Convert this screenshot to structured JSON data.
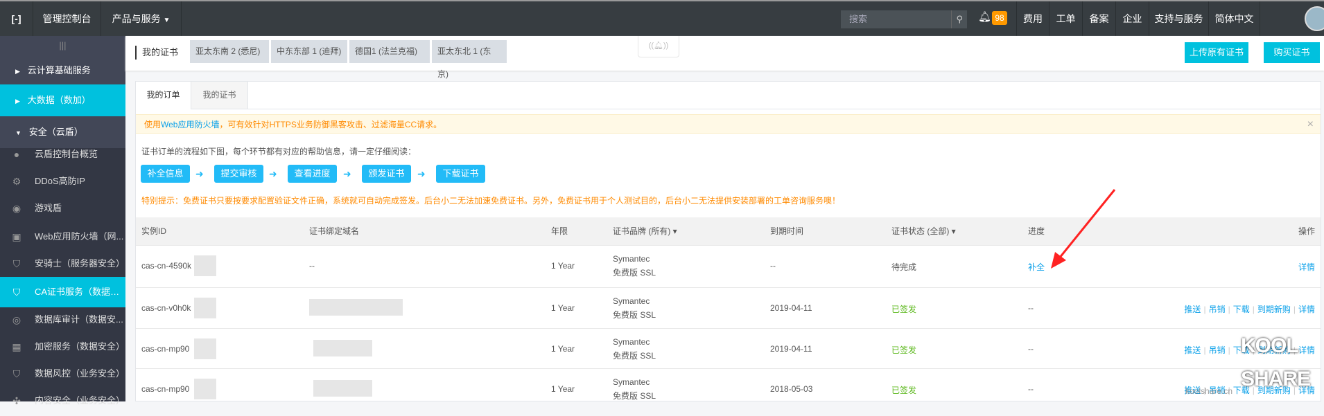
{
  "topbar": {
    "console": "管理控制台",
    "products": "产品与服务",
    "search_placeholder": "搜索",
    "badge": "98",
    "nav": [
      "费用",
      "工单",
      "备案",
      "企业",
      "支持与服务",
      "简体中文"
    ]
  },
  "sidebar": {
    "toggle": "|||",
    "groups": [
      "云计算基础服务",
      "大数据（数加）",
      "安全（云盾）"
    ],
    "items": [
      {
        "label": "云盾控制台概览",
        "icon": "dot-icon"
      },
      {
        "label": "DDoS高防IP",
        "icon": "gear-icon"
      },
      {
        "label": "游戏盾",
        "icon": "game-icon"
      },
      {
        "label": "Web应用防火墙（网...",
        "icon": "firewall-icon"
      },
      {
        "label": "安骑士（服务器安全）",
        "icon": "shield-icon"
      },
      {
        "label": "CA证书服务（数据安...",
        "icon": "certificate-icon"
      },
      {
        "label": "数据库审计（数据安...",
        "icon": "target-icon"
      },
      {
        "label": "加密服务（数据安全）",
        "icon": "lock-icon"
      },
      {
        "label": "数据风控（业务安全）",
        "icon": "shield-f-icon"
      },
      {
        "label": "内容安全（业务安全）",
        "icon": "network-icon"
      }
    ]
  },
  "header": {
    "title": "我的证书",
    "regions": [
      "亚太东南 2 (悉尼)",
      "中东东部 1 (迪拜)",
      "德国1 (法兰克福)",
      "亚太东北 1 (东京)"
    ],
    "upload": "上传原有证书",
    "buy": "购买证书"
  },
  "tabs": [
    "我的订单",
    "我的证书"
  ],
  "alert": {
    "prefix": "使用",
    "link": "Web应用防火墙",
    "suffix": "，可有效针对HTTPS业务防御黑客攻击、过滤海量CC请求。",
    "close": "×"
  },
  "flow": {
    "intro": "证书订单的流程如下图，每个环节都有对应的帮助信息，请一定仔细阅读：",
    "steps": [
      "补全信息",
      "提交审核",
      "查看进度",
      "颁发证书",
      "下载证书"
    ],
    "arrow": "➜",
    "notice": "特别提示：免费证书只要按要求配置验证文件正确，系统就可自动完成签发。后台小二无法加速免费证书。另外，免费证书用于个人测试目的，后台小二无法提供安装部署的工单咨询服务噢！"
  },
  "table": {
    "headers": [
      "实例ID",
      "证书绑定域名",
      "年限",
      "证书品牌 (所有) ▾",
      "到期时间",
      "证书状态 (全部) ▾",
      "进度",
      "操作"
    ],
    "rows": [
      {
        "id": "cas-cn-4590k",
        "domain": "--",
        "years": "1 Year",
        "brand": "Symantec",
        "type": "免费版 SSL",
        "expire": "--",
        "status": "待完成",
        "progress": "补全",
        "actions": [
          "详情"
        ]
      },
      {
        "id": "cas-cn-v0h0k",
        "domain": "",
        "years": "1 Year",
        "brand": "Symantec",
        "type": "免费版 SSL",
        "expire": "2019-04-11",
        "status": "已签发",
        "progress": "--",
        "actions": [
          "推送",
          "吊销",
          "下载",
          "到期新购",
          "详情"
        ]
      },
      {
        "id": "cas-cn-mp90",
        "domain": "",
        "years": "1 Year",
        "brand": "Symantec",
        "type": "免费版 SSL",
        "expire": "2019-04-11",
        "status": "已签发",
        "progress": "--",
        "actions": [
          "推送",
          "吊销",
          "下载",
          "到期新购",
          "详情"
        ]
      },
      {
        "id": "cas-cn-mp90",
        "domain": "",
        "years": "1 Year",
        "brand": "Symantec",
        "type": "免费版 SSL",
        "expire": "2018-05-03",
        "status": "已签发",
        "progress": "--",
        "actions": [
          "推送",
          "吊销",
          "下载",
          "到期新购",
          "详情"
        ]
      }
    ]
  },
  "watermark": {
    "line1": "KOOL",
    "line2": "SHARE",
    "url": "koolshare.cn"
  },
  "colors": {
    "accent": "#00c1de",
    "link": "#0aa0e9",
    "success": "#5cb81c",
    "warning": "#ff8a00"
  }
}
